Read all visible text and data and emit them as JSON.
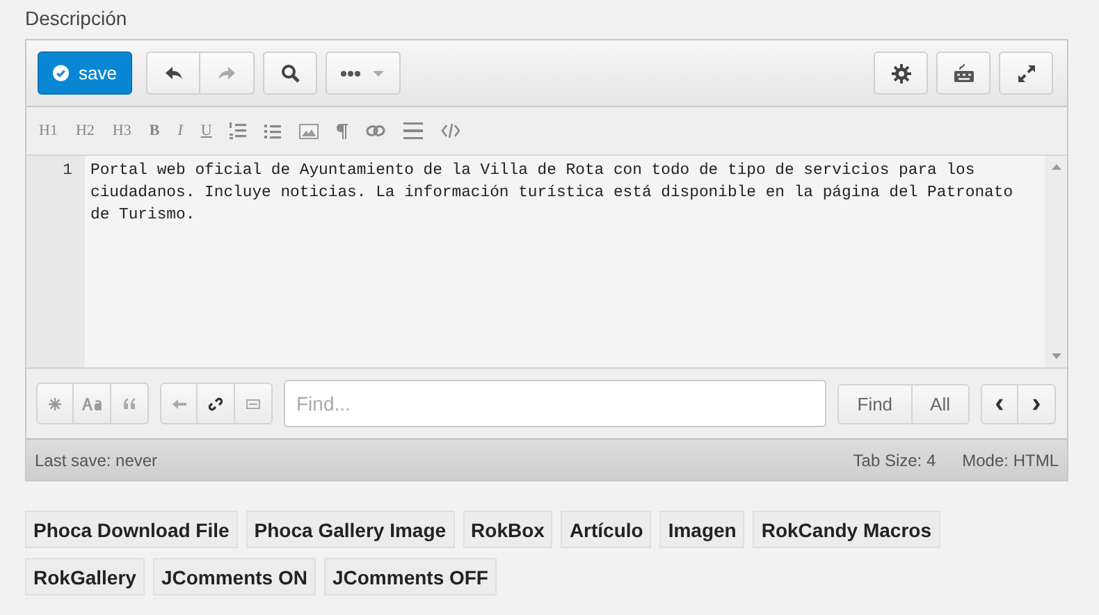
{
  "field_label": "Descripción",
  "toolbar": {
    "save": "save",
    "undo_disabled": false,
    "redo_disabled": true
  },
  "format_buttons": [
    {
      "kind": "heading",
      "label": "H1"
    },
    {
      "kind": "heading",
      "label": "H2"
    },
    {
      "kind": "heading",
      "label": "H3"
    },
    {
      "kind": "bold",
      "label": "B"
    },
    {
      "kind": "italic",
      "label": "I"
    },
    {
      "kind": "underline",
      "label": "U"
    },
    {
      "kind": "ordered-list"
    },
    {
      "kind": "bullet-list"
    },
    {
      "kind": "image"
    },
    {
      "kind": "pilcrow"
    },
    {
      "kind": "link"
    },
    {
      "kind": "rule"
    },
    {
      "kind": "code"
    }
  ],
  "editor": {
    "line_number": "1",
    "text": "Portal web oficial de Ayuntamiento de la Villa de Rota con todo de tipo de servicios para los ciudadanos. Incluye noticias. La información turística está disponible en la página del Patronato de Turismo."
  },
  "search": {
    "placeholder": "Find...",
    "find": "Find",
    "all": "All",
    "prev": "‹",
    "next": "›"
  },
  "status_bar": {
    "last_save": "Last save: never",
    "tab_size": "Tab Size: 4",
    "mode": "Mode: HTML"
  },
  "plugin_buttons": [
    "Phoca Download File",
    "Phoca Gallery Image",
    "RokBox",
    "Artículo",
    "Imagen",
    "RokCandy Macros",
    "RokGallery",
    "JComments ON",
    "JComments OFF"
  ]
}
